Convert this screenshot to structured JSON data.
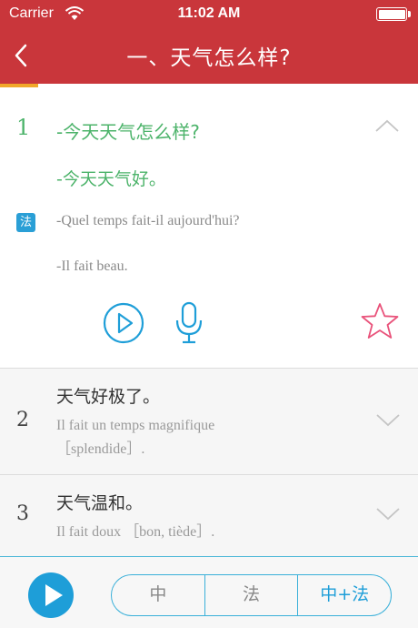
{
  "status_bar": {
    "carrier": "Carrier",
    "time": "11:02 AM"
  },
  "nav": {
    "title": "一、天气怎么样?",
    "back_icon": "chevron-left-icon"
  },
  "colors": {
    "header": "#c9363b",
    "accent_green": "#4cb36a",
    "accent_blue": "#1e9ed8",
    "star_pink": "#e9527a",
    "progress": "#f1a729"
  },
  "items": [
    {
      "number": "1",
      "question_zh": "-今天天气怎么样?",
      "answer_zh": "-今天天气好。",
      "lang_badge": "法",
      "question_fr": "-Quel temps fait-il aujourd'hui?",
      "answer_fr": "-Il fait beau."
    },
    {
      "number": "2",
      "zh": "天气好极了。",
      "fr_line1": "Il fait un temps magnifique",
      "fr_line2": "［splendide］."
    },
    {
      "number": "3",
      "zh": "天气温和。",
      "fr_line1": "Il fait doux ［bon, tiède］."
    }
  ],
  "bottom": {
    "modes": [
      "中",
      "法",
      "中+法"
    ],
    "selected_mode": "中+法"
  }
}
